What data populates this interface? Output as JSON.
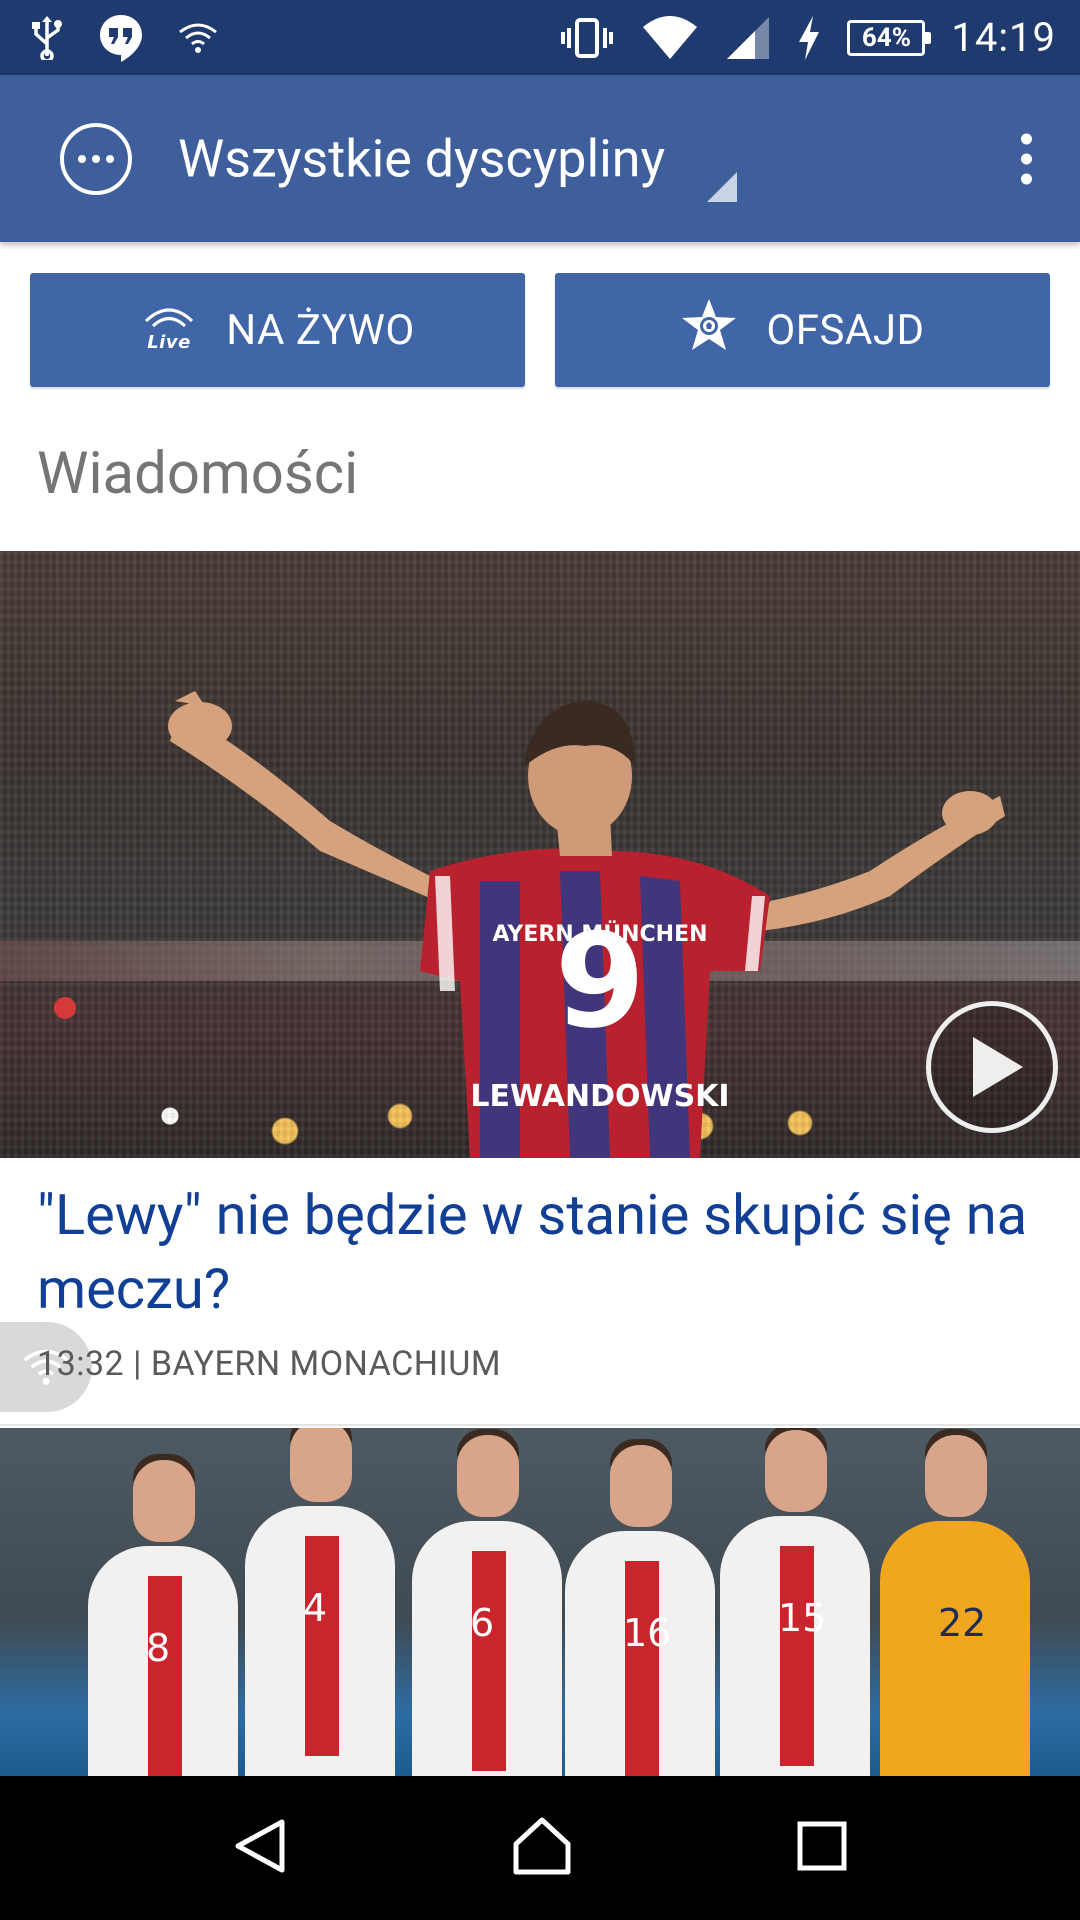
{
  "status_bar": {
    "left_icons": [
      "usb-icon",
      "hangouts-icon",
      "wifi-icon"
    ],
    "right_icons": [
      "vibrate-icon",
      "wifi-strong-icon",
      "signal-icon",
      "charging-icon"
    ],
    "battery": "64%",
    "time": "14:19"
  },
  "app_bar": {
    "title": "Wszystkie dyscypliny",
    "menu_icon": "more-circle-icon",
    "overflow_icon": "overflow-menu-icon",
    "color": "#3f5f9c"
  },
  "quick_buttons": [
    {
      "label": "NA ŻYWO",
      "icon": "live-icon"
    },
    {
      "label": "OFSAJD",
      "icon": "star-ball-icon"
    }
  ],
  "section": {
    "title": "Wiadomości"
  },
  "articles": [
    {
      "title": "\"Lewy\" nie będzie w stanie skupić się na meczu?",
      "meta": "13:32 | BAYERN MONACHIUM",
      "has_video": true,
      "image_alt": "player-celebrating-image"
    },
    {
      "image_alt": "team-photo-image",
      "player_numbers": [
        "8",
        "4",
        "6",
        "16",
        "15",
        "22"
      ]
    }
  ],
  "nav_bar": {
    "icons": [
      "back-icon",
      "home-icon",
      "recents-icon"
    ]
  },
  "colors": {
    "status_bar": "#1f3a6e",
    "app_bar": "#3f5f9c",
    "button": "#4066a8",
    "headline": "#123f96"
  }
}
